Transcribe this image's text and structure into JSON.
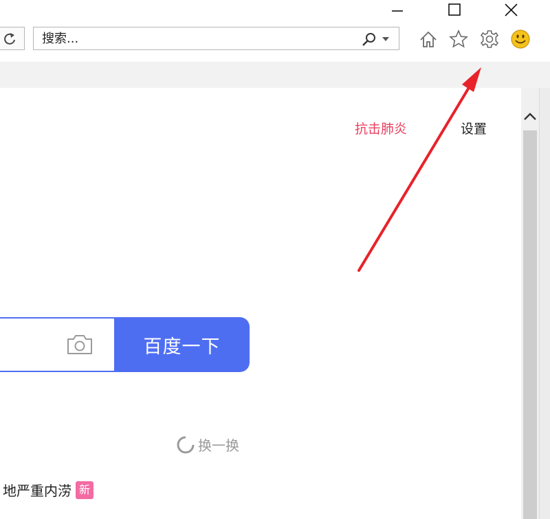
{
  "window": {
    "minimize_icon": "minimize-icon",
    "maximize_icon": "maximize-icon",
    "close_icon": "close-icon"
  },
  "toolbar": {
    "search_placeholder": "搜索...",
    "icons": [
      "refresh-icon",
      "search-icon",
      "chevron-down-icon",
      "home-icon",
      "star-icon",
      "gear-icon",
      "smiley-icon"
    ]
  },
  "topnav": {
    "red_link": "抗击肺炎",
    "settings": "设置"
  },
  "search": {
    "button_label": "百度一下",
    "accent_color": "#4e6ef2"
  },
  "hot": {
    "refresh_label": "换一换",
    "item_text": "地严重内涝",
    "item_badge": "新"
  },
  "annotation": {
    "arrow_color": "#e8222a"
  }
}
